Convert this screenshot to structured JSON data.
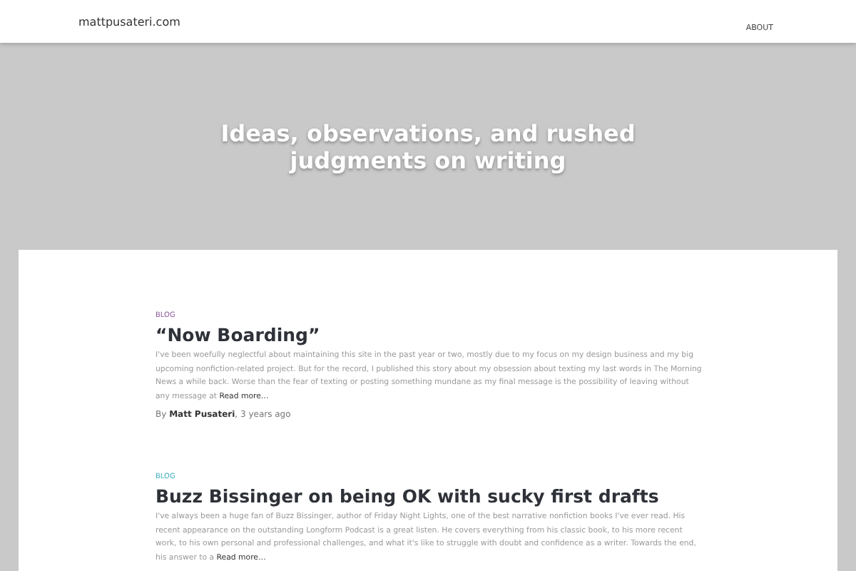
{
  "header": {
    "site_title": "mattpusateri.com",
    "nav": [
      {
        "label": "ABOUT"
      }
    ]
  },
  "hero": {
    "tagline": "Ideas, observations, and rushed judgments on writing"
  },
  "posts": [
    {
      "category": "BLOG",
      "color": "#8e5b9e",
      "title": "“Now Boarding”",
      "excerpt": "I've been woefully neglectful about maintaining this site in the past year or two, mostly due to my focus on my design business and my big upcoming nonfiction-related project. But for the record, I published this story about my obsession about texting my last words in The Morning News a while back. Worse than the fear of texting or posting something mundane as my final message is the possibility of leaving without any message at",
      "read_more": "Read more…",
      "byline": "By **Matt Pusateri**, 3 years ago"
    },
    {
      "category": "BLOG",
      "color": "#3fb0c0",
      "title": "Buzz Bissinger on being OK with sucky first drafts",
      "excerpt": "I've always been a huge fan of Buzz Bissinger, author of Friday Night Lights, one of the best narrative nonfiction books I've ever read. His recent appearance on the outstanding Longform Podcast is a great listen. He covers everything from his classic book, to his more recent work, to his own personal and professional challenges, and what it's like to struggle with doubt and confidence as a writer. Towards the end, his answer to a",
      "read_more": "Read more…"
    }
  ]
}
